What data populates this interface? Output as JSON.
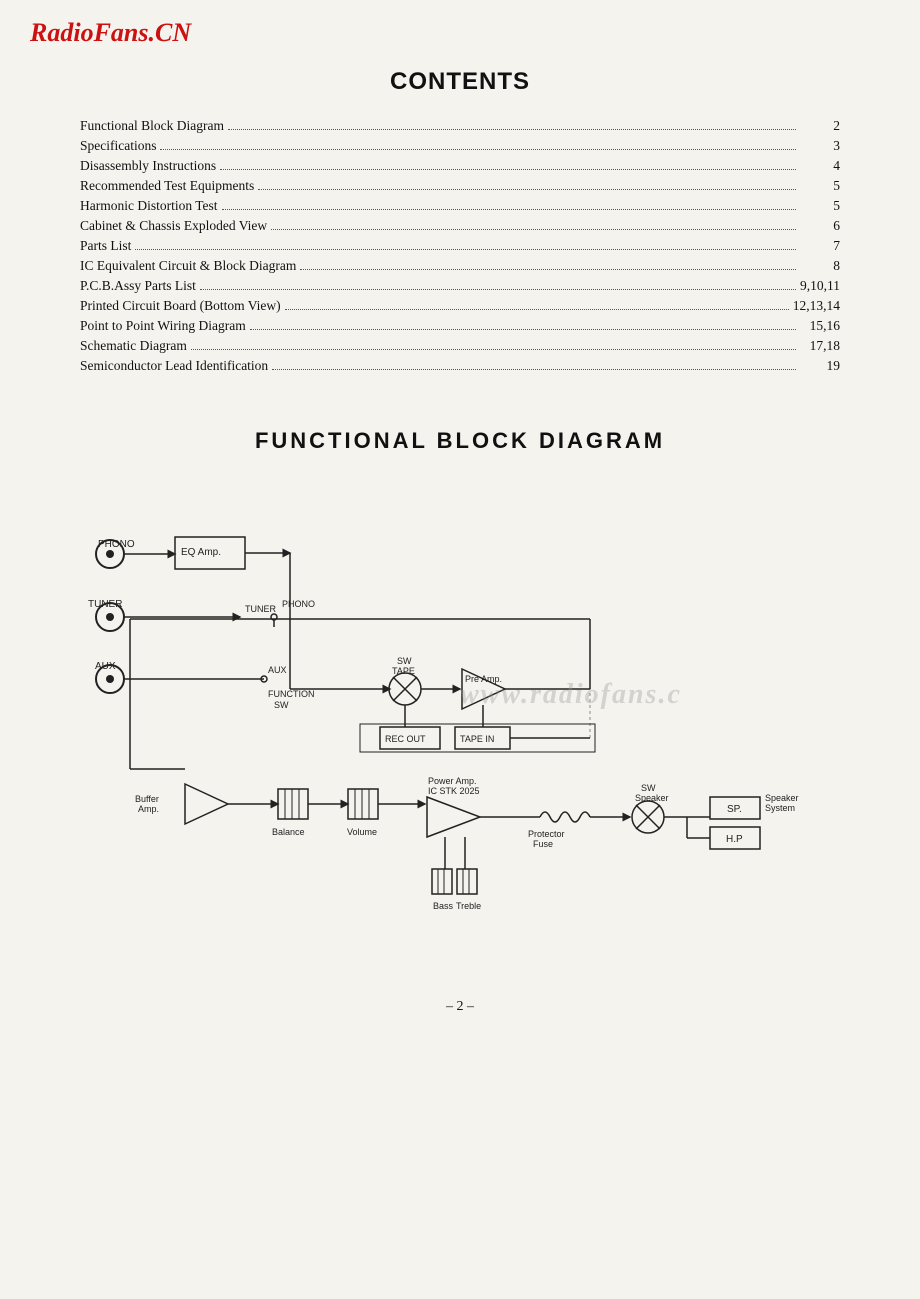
{
  "header": {
    "logo": "RadioFans.CN"
  },
  "contents": {
    "title": "CONTENTS",
    "items": [
      {
        "label": "Functional Block Diagram",
        "page": "2"
      },
      {
        "label": "Specifications",
        "page": "3"
      },
      {
        "label": "Disassembly Instructions",
        "page": "4"
      },
      {
        "label": "Recommended Test Equipments",
        "page": "5"
      },
      {
        "label": "Harmonic Distortion Test",
        "page": "5"
      },
      {
        "label": "Cabinet & Chassis Exploded View",
        "page": "6"
      },
      {
        "label": "Parts List",
        "page": "7"
      },
      {
        "label": "IC Equivalent Circuit & Block Diagram",
        "page": "8"
      },
      {
        "label": "P.C.B.Assy Parts List",
        "page": "9,10,11"
      },
      {
        "label": "Printed Circuit Board (Bottom View)",
        "page": "12,13,14"
      },
      {
        "label": "Point to Point Wiring Diagram",
        "page": "15,16"
      },
      {
        "label": "Schematic Diagram",
        "page": "17,18"
      },
      {
        "label": "Semiconductor Lead Identification",
        "page": "19"
      }
    ]
  },
  "block_diagram": {
    "title": "FUNCTIONAL  BLOCK  DIAGRAM"
  },
  "page_number": "– 2 –"
}
